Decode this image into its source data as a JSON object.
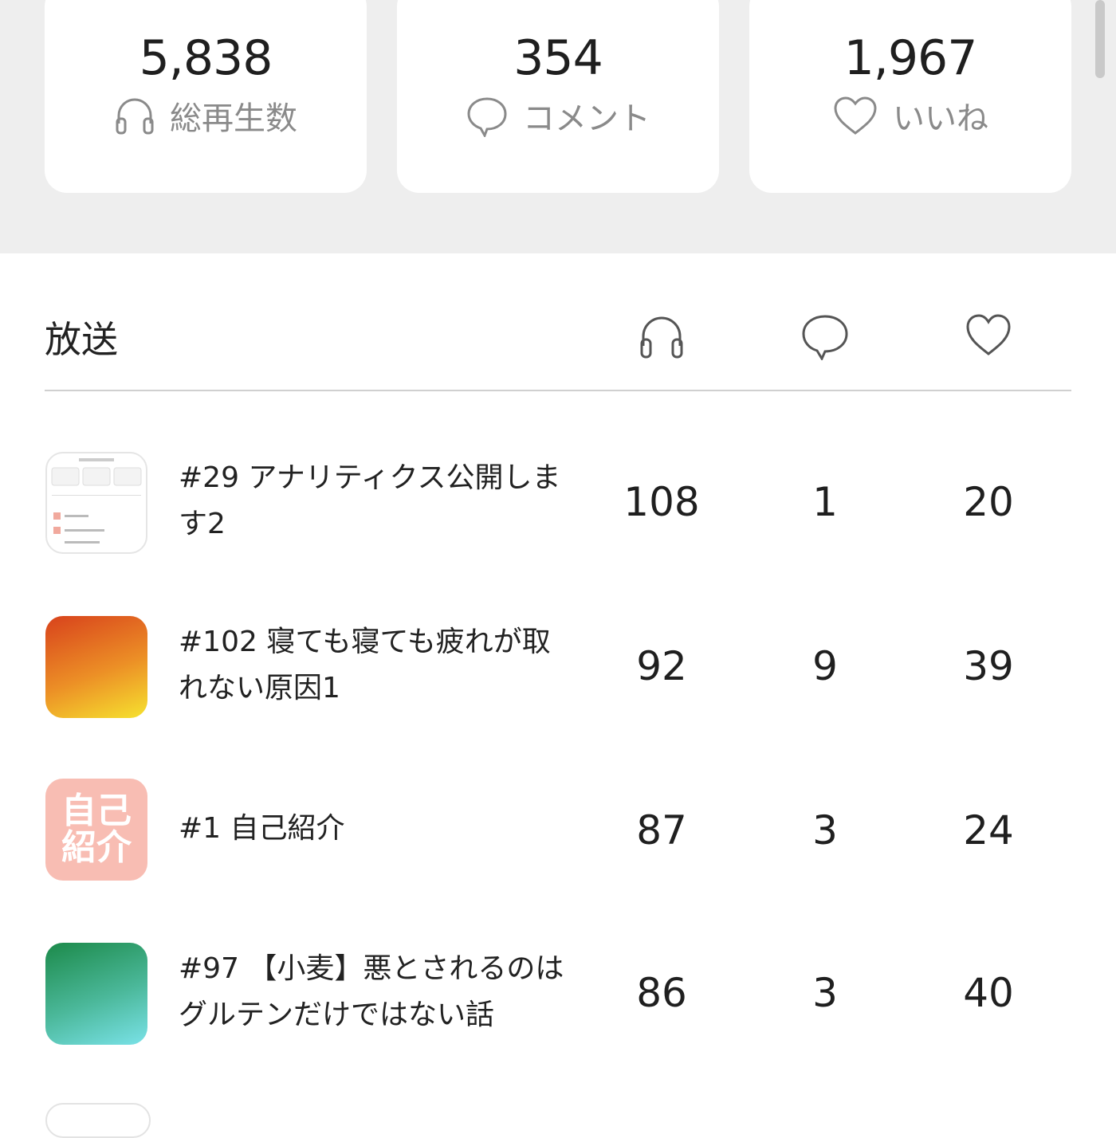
{
  "summary": {
    "plays": {
      "value": "5,838",
      "label": "総再生数",
      "icon": "headphones-icon"
    },
    "comments": {
      "value": "354",
      "label": "コメント",
      "icon": "speech-bubble-icon"
    },
    "likes": {
      "value": "1,967",
      "label": "いいね",
      "icon": "heart-icon"
    }
  },
  "section": {
    "title": "放送",
    "columns": [
      "headphones-icon",
      "speech-bubble-icon",
      "heart-icon"
    ]
  },
  "episodes": [
    {
      "title": "#29 アナリティクス公開します2",
      "plays": "108",
      "comments": "1",
      "likes": "20",
      "thumb": "screenshot"
    },
    {
      "title": "#102 寝ても寝ても疲れが取れない原因1",
      "plays": "92",
      "comments": "9",
      "likes": "39",
      "thumb_colors": [
        "#d8421c",
        "#f6e22f"
      ]
    },
    {
      "title": "#1 自己紹介",
      "plays": "87",
      "comments": "3",
      "likes": "24",
      "thumb_text": "自己紹介",
      "thumb_color": "#f8bdb3"
    },
    {
      "title": "#97 【小麦】悪とされるのはグルテンだけではない話",
      "plays": "86",
      "comments": "3",
      "likes": "40",
      "thumb_colors": [
        "#1c8a4a",
        "#7ae2e8"
      ]
    }
  ]
}
